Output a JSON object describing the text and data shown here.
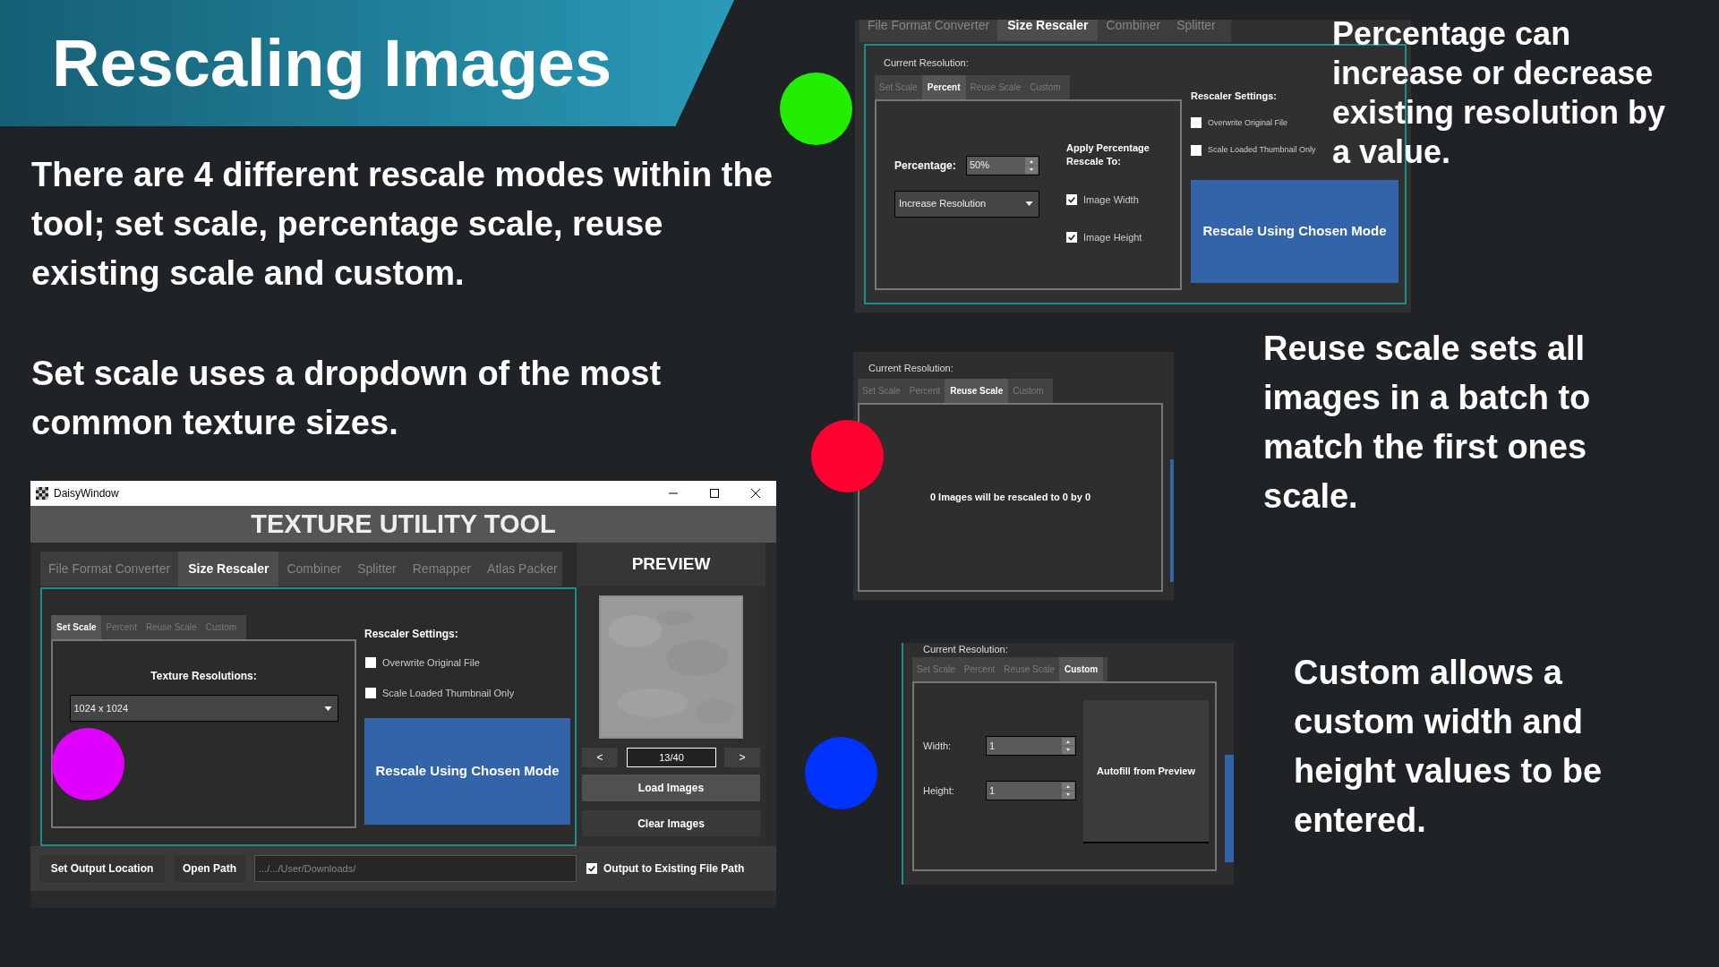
{
  "title": "Rescaling Images",
  "paragraphs": [
    "There are 4 different rescale modes within the tool; set scale, percentage scale, reuse existing scale and custom.",
    "Set scale uses a dropdown of the most common texture sizes."
  ],
  "main_window": {
    "title": "DaisyWindow",
    "app_title": "TEXTURE UTILITY TOOL",
    "tabs": [
      {
        "label": "File Format Converter",
        "selected": false
      },
      {
        "label": "Size Rescaler",
        "selected": true
      },
      {
        "label": "Combiner",
        "selected": false
      },
      {
        "label": "Splitter",
        "selected": false
      },
      {
        "label": "Remapper",
        "selected": false
      },
      {
        "label": "Atlas Packer",
        "selected": false
      }
    ],
    "mode_tabs": [
      {
        "label": "Set Scale",
        "selected": true
      },
      {
        "label": "Percent",
        "selected": false
      },
      {
        "label": "Reuse Scale",
        "selected": false
      },
      {
        "label": "Custom",
        "selected": false
      }
    ],
    "resolution_label": "Texture Resolutions:",
    "resolution_value": "1024 x 1024",
    "settings_title": "Rescaler Settings:",
    "settings": [
      {
        "label": "Overwrite Original File",
        "checked": false
      },
      {
        "label": "Scale Loaded Thumbnail Only",
        "checked": false
      }
    ],
    "rescale_button": "Rescale Using Chosen Mode",
    "preview_title": "PREVIEW",
    "previous_button": "<",
    "counter": "13/40",
    "next_button": ">",
    "load_button": "Load Images",
    "clear_button": "Clear Images",
    "output_button": "Set Output Location",
    "open_button": "Open Path",
    "path_value": ".../.../User/Downloads/",
    "output_option": {
      "label": "Output to Existing File Path",
      "checked": true
    }
  },
  "percent_panel": {
    "tabs": [
      {
        "label": "File Format Converter",
        "selected": false
      },
      {
        "label": "Size Rescaler",
        "selected": true
      },
      {
        "label": "Combiner",
        "selected": false
      },
      {
        "label": "Splitter",
        "selected": false
      }
    ],
    "current_resolution": "Current Resolution:",
    "mode_tabs": [
      {
        "label": "Set Scale",
        "selected": false
      },
      {
        "label": "Percent",
        "selected": true
      },
      {
        "label": "Reuse Scale",
        "selected": false
      },
      {
        "label": "Custom",
        "selected": false
      }
    ],
    "percentage_label": "Percentage:",
    "percentage_value": "50%",
    "direction_value": "Increase Resolution",
    "apply_label": "Apply Percentage Rescale To:",
    "apply_options": [
      {
        "label": "Image Width",
        "checked": true
      },
      {
        "label": "Image Height",
        "checked": true
      }
    ],
    "settings_title": "Rescaler Settings:",
    "settings": [
      {
        "label": "Overwrite Original File",
        "checked": false
      },
      {
        "label": "Scale Loaded Thumbnail Only",
        "checked": false
      }
    ],
    "rescale_button": "Rescale Using Chosen Mode"
  },
  "reuse_panel": {
    "current_resolution": "Current Resolution:",
    "mode_tabs": [
      {
        "label": "Set Scale",
        "selected": false
      },
      {
        "label": "Percent",
        "selected": false
      },
      {
        "label": "Reuse Scale",
        "selected": true
      },
      {
        "label": "Custom",
        "selected": false
      }
    ],
    "message": "0 Images will be rescaled to 0 by 0"
  },
  "custom_panel": {
    "current_resolution": "Current Resolution:",
    "mode_tabs": [
      {
        "label": "Set Scale",
        "selected": false
      },
      {
        "label": "Percent",
        "selected": false
      },
      {
        "label": "Reuse Scale",
        "selected": false
      },
      {
        "label": "Custom",
        "selected": true
      }
    ],
    "width_label": "Width:",
    "width_value": "1",
    "height_label": "Height:",
    "height_value": "1",
    "autofill_button": "Autofill from Preview"
  },
  "markers": [
    {
      "color": "#e000ff"
    },
    {
      "color": "#22ee00"
    },
    {
      "color": "#ff0030"
    },
    {
      "color": "#0033ff"
    }
  ],
  "captions": [
    "Percentage can increase or decrease existing resolution by a value.",
    "Reuse scale sets all images in a batch to match the first ones scale.",
    "Custom allows a custom width and height values to be entered."
  ]
}
